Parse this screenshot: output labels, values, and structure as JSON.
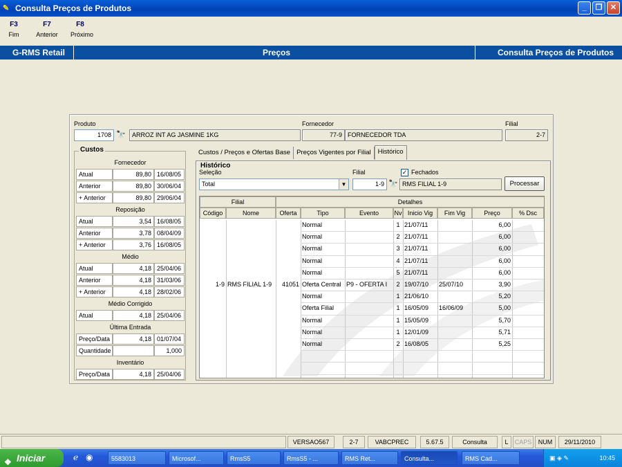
{
  "window": {
    "title": "Consulta Preços de Produtos"
  },
  "fkeys": [
    {
      "key": "F3",
      "label": "Fim"
    },
    {
      "key": "F7",
      "label": "Anterior"
    },
    {
      "key": "F8",
      "label": "Próximo"
    }
  ],
  "header": {
    "left": "G-RMS Retail",
    "center": "Preços",
    "right": "Consulta Preços de Produtos"
  },
  "product": {
    "produto_label": "Produto",
    "produto_code": "1708",
    "produto_desc": "ARROZ INT AG JASMINE 1KG",
    "fornecedor_label": "Fornecedor",
    "fornecedor_code": "77-9",
    "fornecedor_name": "FORNECEDOR TDA",
    "filial_label": "Filial",
    "filial_value": "2-7"
  },
  "custos": {
    "title": "Custos",
    "sections": [
      {
        "header": "Fornecedor",
        "rows": [
          [
            "Atual",
            "89,80",
            "16/08/05"
          ],
          [
            "Anterior",
            "89,80",
            "30/06/04"
          ],
          [
            "+ Anterior",
            "89,80",
            "29/06/04"
          ]
        ]
      },
      {
        "header": "Reposição",
        "rows": [
          [
            "Atual",
            "3,54",
            "16/08/05"
          ],
          [
            "Anterior",
            "3,78",
            "08/04/09"
          ],
          [
            "+ Anterior",
            "3,76",
            "16/08/05"
          ]
        ]
      },
      {
        "header": "Médio",
        "rows": [
          [
            "Atual",
            "4,18",
            "25/04/06"
          ],
          [
            "Anterior",
            "4,18",
            "31/03/06"
          ],
          [
            "+ Anterior",
            "4,18",
            "28/02/06"
          ]
        ]
      },
      {
        "header": "Médio Corrigido",
        "rows": [
          [
            "Atual",
            "4,18",
            "25/04/06"
          ]
        ]
      },
      {
        "header": "Última Entrada",
        "rows": [
          [
            "Preço/Data",
            "4,18",
            "01/07/04"
          ],
          [
            "Quantidade",
            "",
            "1,000"
          ]
        ]
      },
      {
        "header": "Inventário",
        "rows": [
          [
            "Preço/Data",
            "4,18",
            "25/04/06"
          ]
        ]
      }
    ]
  },
  "tabs": [
    "Custos / Preços e Ofertas Base",
    "Preços Vigentes por Filial",
    "Histórico"
  ],
  "historico": {
    "title": "Histórico",
    "selecao_label": "Seleção",
    "selecao_value": "Total",
    "filial_label": "Filial",
    "filial_code": "1-9",
    "filial_name": "RMS FILIAL 1-9",
    "fechados_label": "Fechados",
    "fechados_checked": true,
    "processar_label": "Processar"
  },
  "grid": {
    "group_filial": "Filial",
    "group_detalhes": "Detalhes",
    "columns": [
      "Código",
      "Nome",
      "Oferta",
      "Tipo",
      "Evento",
      "Nv",
      "Inicio Vig",
      "Fim Vig",
      "Preço",
      "% Dsc"
    ],
    "filial_codigo": "1-9",
    "filial_nome": "RMS FILIAL 1-9",
    "filial_oferta": "41051",
    "rows": [
      {
        "tipo": "Normal",
        "evento": "",
        "nv": "1",
        "inicio": "21/07/11",
        "fim": "",
        "preco": "6,00"
      },
      {
        "tipo": "Normal",
        "evento": "",
        "nv": "2",
        "inicio": "21/07/11",
        "fim": "",
        "preco": "6,00"
      },
      {
        "tipo": "Normal",
        "evento": "",
        "nv": "3",
        "inicio": "21/07/11",
        "fim": "",
        "preco": "6,00"
      },
      {
        "tipo": "Normal",
        "evento": "",
        "nv": "4",
        "inicio": "21/07/11",
        "fim": "",
        "preco": "6,00"
      },
      {
        "tipo": "Normal",
        "evento": "",
        "nv": "5",
        "inicio": "21/07/11",
        "fim": "",
        "preco": "6,00"
      },
      {
        "tipo": "Oferta Central",
        "evento": "P9 - OFERTA I",
        "nv": "2",
        "inicio": "19/07/10",
        "fim": "25/07/10",
        "preco": "3,90"
      },
      {
        "tipo": "Normal",
        "evento": "",
        "nv": "1",
        "inicio": "21/06/10",
        "fim": "",
        "preco": "5,20"
      },
      {
        "tipo": "Oferta Filial",
        "evento": "",
        "nv": "1",
        "inicio": "16/05/09",
        "fim": "16/06/09",
        "preco": "5,00"
      },
      {
        "tipo": "Normal",
        "evento": "",
        "nv": "1",
        "inicio": "15/05/09",
        "fim": "",
        "preco": "5,70"
      },
      {
        "tipo": "Normal",
        "evento": "",
        "nv": "1",
        "inicio": "12/01/09",
        "fim": "",
        "preco": "5,71"
      },
      {
        "tipo": "Normal",
        "evento": "",
        "nv": "2",
        "inicio": "16/08/05",
        "fim": "",
        "preco": "5,25"
      }
    ]
  },
  "statusbar": [
    "VERSAO567",
    "2-7",
    "VABCPREC",
    "5.67.5",
    "Consulta",
    "L",
    "CAPS",
    "NUM",
    "29/11/2010"
  ],
  "taskbar": {
    "start": "Iniciar",
    "items": [
      "5583013",
      "Microsof...",
      "RmsS5",
      "RmsS5 - ...",
      "RMS Ret...",
      "Consulta...",
      "RMS Cad..."
    ],
    "clock": "10:45"
  },
  "colors": {
    "title_blue": "#0a5fd8",
    "header_blue": "#0b4fa0",
    "panel_bg": "#ece9d8"
  }
}
